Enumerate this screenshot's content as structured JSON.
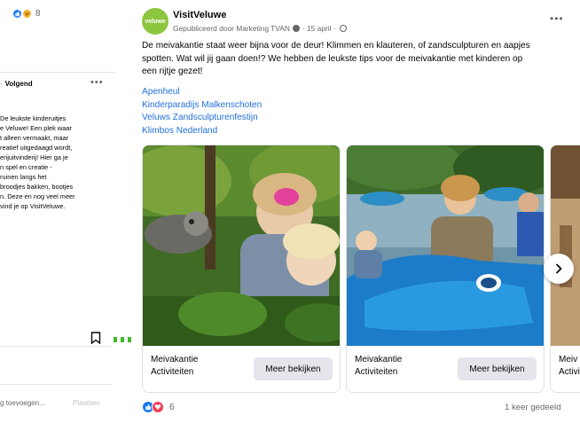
{
  "left_post": {
    "reaction_count": "8",
    "follow_label": "Volgend",
    "text_lines": [
      "De leukste kinderuitjes",
      "e Veluwe! Een plek waar",
      "t alleen vermaakt, maar",
      "reatief uitgedaagd wordt,",
      "erijuitvinderij! Hier ga je",
      "n spel en creatie -",
      "ruinen langs het",
      "broodjes bakken, bootjes",
      "n. Deze en nog veel meer",
      "vind je op VisitVeluwe."
    ],
    "comment_placeholder": "g toevoegen...",
    "post_label": "Plaatsen"
  },
  "post": {
    "avatar_text": "veluwe",
    "page_name": "VisitVeluwe",
    "meta": {
      "published_by": "Gepubliceerd door Marketing TVAN",
      "date": "· 15 april ·"
    },
    "body_lines": [
      "De meivakantie staat weer bijna voor de deur! Klimmen en klauteren, of zandsculpturen en aapjes",
      "spotten. Wat wil jij gaan doen!? We hebben de leukste tips voor de meivakantie met kinderen op",
      "een rijtje gezet!"
    ],
    "links": [
      "Apenheul",
      "Kinderparadijs Malkenschoten",
      "Veluws Zandsculpturenfestijn",
      "Klimbos Nederland"
    ],
    "cards": [
      {
        "caption_line1": "Meivakantie",
        "caption_line2": "Activiteiten",
        "button": "Meer bekijken"
      },
      {
        "caption_line1": "Meivakantie",
        "caption_line2": "Activiteiten",
        "button": "Meer bekijken"
      },
      {
        "caption_line1": "Meiv",
        "caption_line2": "Activi",
        "button": ""
      }
    ],
    "reaction_count": "6",
    "shares": "1 keer gedeeld"
  },
  "colors": {
    "link": "#216fdb",
    "like": "#1877f2",
    "love": "#f33e58",
    "brand_green": "#8cc63f",
    "muted": "#65676b"
  },
  "icons": [
    "like-icon",
    "haha-icon",
    "love-icon",
    "globe-icon",
    "bookmark-icon",
    "chevron-right-icon",
    "more-options-icon"
  ]
}
